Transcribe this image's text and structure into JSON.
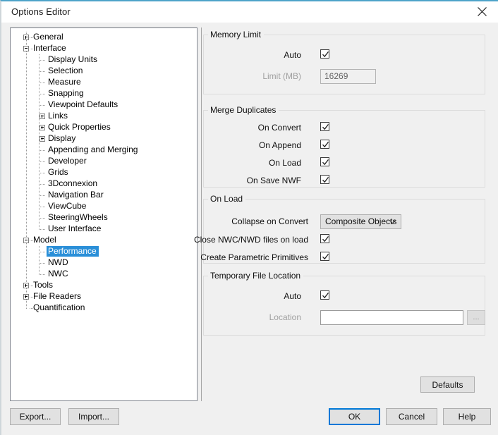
{
  "window": {
    "title": "Options Editor",
    "close_icon": "close-icon",
    "accent_color": "#0078d7",
    "selection_color": "#2a8fd8"
  },
  "tree": {
    "selected": "Performance",
    "items": [
      {
        "label": "General",
        "depth": 0,
        "toggle": "plus"
      },
      {
        "label": "Interface",
        "depth": 0,
        "toggle": "minus"
      },
      {
        "label": "Display Units",
        "depth": 1,
        "toggle": "none"
      },
      {
        "label": "Selection",
        "depth": 1,
        "toggle": "none"
      },
      {
        "label": "Measure",
        "depth": 1,
        "toggle": "none"
      },
      {
        "label": "Snapping",
        "depth": 1,
        "toggle": "none"
      },
      {
        "label": "Viewpoint Defaults",
        "depth": 1,
        "toggle": "none"
      },
      {
        "label": "Links",
        "depth": 1,
        "toggle": "plus"
      },
      {
        "label": "Quick Properties",
        "depth": 1,
        "toggle": "plus"
      },
      {
        "label": "Display",
        "depth": 1,
        "toggle": "plus"
      },
      {
        "label": "Appending and Merging",
        "depth": 1,
        "toggle": "none"
      },
      {
        "label": "Developer",
        "depth": 1,
        "toggle": "none"
      },
      {
        "label": "Grids",
        "depth": 1,
        "toggle": "none"
      },
      {
        "label": "3Dconnexion",
        "depth": 1,
        "toggle": "none"
      },
      {
        "label": "Navigation Bar",
        "depth": 1,
        "toggle": "none"
      },
      {
        "label": "ViewCube",
        "depth": 1,
        "toggle": "none"
      },
      {
        "label": "SteeringWheels",
        "depth": 1,
        "toggle": "none"
      },
      {
        "label": "User Interface",
        "depth": 1,
        "toggle": "none"
      },
      {
        "label": "Model",
        "depth": 0,
        "toggle": "minus"
      },
      {
        "label": "Performance",
        "depth": 1,
        "toggle": "none"
      },
      {
        "label": "NWD",
        "depth": 1,
        "toggle": "none"
      },
      {
        "label": "NWC",
        "depth": 1,
        "toggle": "none"
      },
      {
        "label": "Tools",
        "depth": 0,
        "toggle": "plus"
      },
      {
        "label": "File Readers",
        "depth": 0,
        "toggle": "plus"
      },
      {
        "label": "Quantification",
        "depth": 0,
        "toggle": "none"
      }
    ]
  },
  "settings": {
    "memory_limit": {
      "title": "Memory Limit",
      "auto_label": "Auto",
      "auto_checked": true,
      "limit_label": "Limit (MB)",
      "limit_value": "16269",
      "limit_enabled": false
    },
    "merge_duplicates": {
      "title": "Merge Duplicates",
      "rows": [
        {
          "label": "On Convert",
          "checked": true
        },
        {
          "label": "On Append",
          "checked": true
        },
        {
          "label": "On Load",
          "checked": true
        },
        {
          "label": "On Save NWF",
          "checked": true
        }
      ]
    },
    "on_load": {
      "title": "On Load",
      "collapse_label": "Collapse on Convert",
      "collapse_value": "Composite Objects",
      "collapse_options": [
        "Composite Objects"
      ],
      "rows": [
        {
          "label": "Close NWC/NWD files on load",
          "checked": true
        },
        {
          "label": "Create Parametric Primitives",
          "checked": true
        }
      ]
    },
    "temp_file_location": {
      "title": "Temporary File Location",
      "auto_label": "Auto",
      "auto_checked": true,
      "location_label": "Location",
      "location_value": "",
      "location_enabled": false,
      "browse_label": "...",
      "browse_enabled": false
    },
    "defaults_label": "Defaults"
  },
  "footer": {
    "export_label": "Export...",
    "import_label": "Import...",
    "ok_label": "OK",
    "cancel_label": "Cancel",
    "help_label": "Help"
  }
}
